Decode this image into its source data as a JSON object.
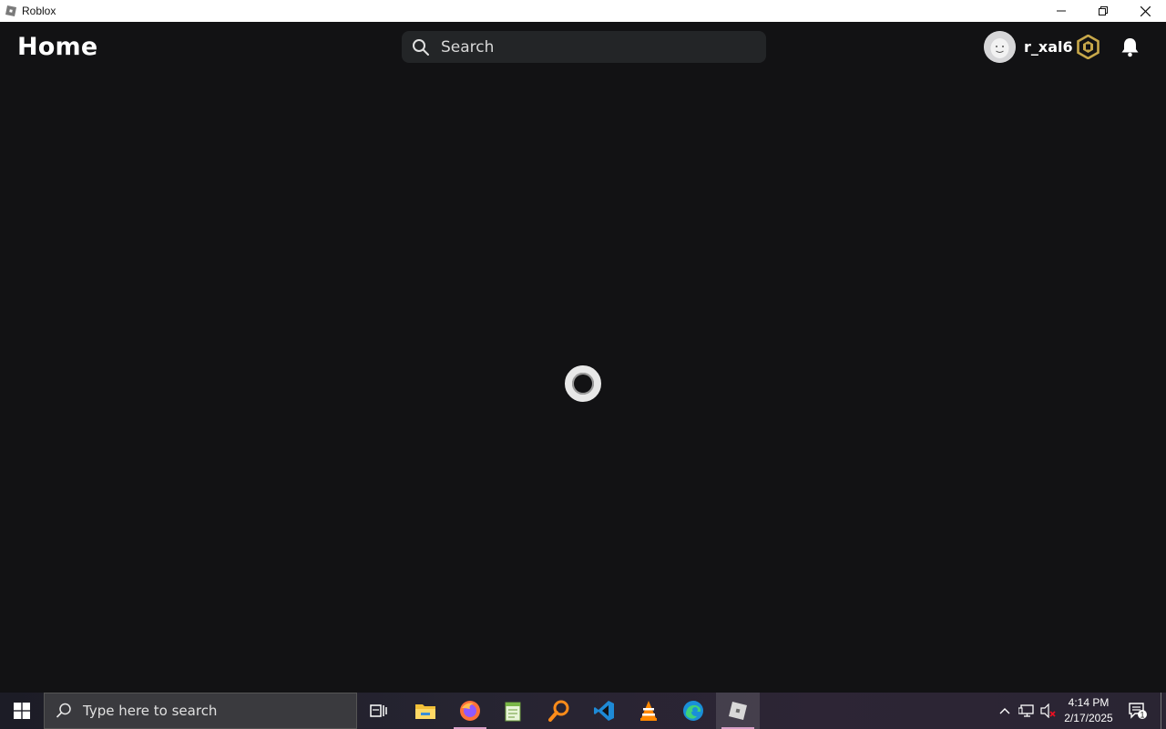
{
  "window": {
    "title": "Roblox"
  },
  "header": {
    "page_title": "Home",
    "search_placeholder": "Search",
    "username": "r_xal6"
  },
  "taskbar": {
    "search_placeholder": "Type here to search",
    "clock_time": "4:14 PM",
    "clock_date": "2/17/2025",
    "notification_count": "1",
    "apps": [
      "task-view-icon",
      "file-explorer-icon",
      "firefox-icon",
      "notepad-plus-icon",
      "search-app-icon",
      "vscode-icon",
      "vlc-icon",
      "edge-icon",
      "roblox-icon"
    ]
  },
  "colors": {
    "background": "#121214",
    "search_bg": "#232527",
    "robux_gold": "#c8a84a",
    "accent_underline": "#d8a0c8"
  }
}
